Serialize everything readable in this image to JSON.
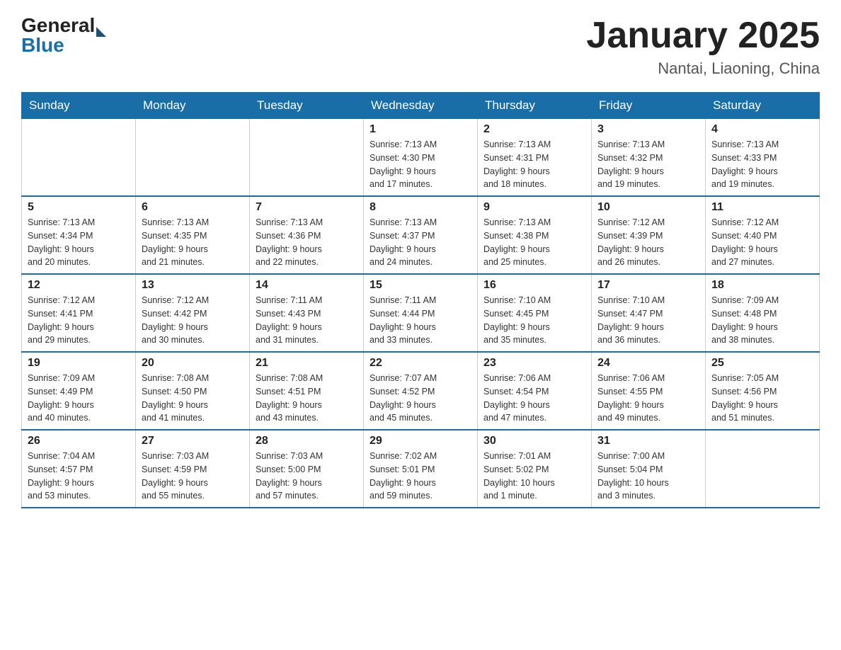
{
  "header": {
    "logo_general": "General",
    "logo_blue": "Blue",
    "title": "January 2025",
    "subtitle": "Nantai, Liaoning, China"
  },
  "days_of_week": [
    "Sunday",
    "Monday",
    "Tuesday",
    "Wednesday",
    "Thursday",
    "Friday",
    "Saturday"
  ],
  "weeks": [
    [
      {
        "day": "",
        "info": ""
      },
      {
        "day": "",
        "info": ""
      },
      {
        "day": "",
        "info": ""
      },
      {
        "day": "1",
        "info": "Sunrise: 7:13 AM\nSunset: 4:30 PM\nDaylight: 9 hours\nand 17 minutes."
      },
      {
        "day": "2",
        "info": "Sunrise: 7:13 AM\nSunset: 4:31 PM\nDaylight: 9 hours\nand 18 minutes."
      },
      {
        "day": "3",
        "info": "Sunrise: 7:13 AM\nSunset: 4:32 PM\nDaylight: 9 hours\nand 19 minutes."
      },
      {
        "day": "4",
        "info": "Sunrise: 7:13 AM\nSunset: 4:33 PM\nDaylight: 9 hours\nand 19 minutes."
      }
    ],
    [
      {
        "day": "5",
        "info": "Sunrise: 7:13 AM\nSunset: 4:34 PM\nDaylight: 9 hours\nand 20 minutes."
      },
      {
        "day": "6",
        "info": "Sunrise: 7:13 AM\nSunset: 4:35 PM\nDaylight: 9 hours\nand 21 minutes."
      },
      {
        "day": "7",
        "info": "Sunrise: 7:13 AM\nSunset: 4:36 PM\nDaylight: 9 hours\nand 22 minutes."
      },
      {
        "day": "8",
        "info": "Sunrise: 7:13 AM\nSunset: 4:37 PM\nDaylight: 9 hours\nand 24 minutes."
      },
      {
        "day": "9",
        "info": "Sunrise: 7:13 AM\nSunset: 4:38 PM\nDaylight: 9 hours\nand 25 minutes."
      },
      {
        "day": "10",
        "info": "Sunrise: 7:12 AM\nSunset: 4:39 PM\nDaylight: 9 hours\nand 26 minutes."
      },
      {
        "day": "11",
        "info": "Sunrise: 7:12 AM\nSunset: 4:40 PM\nDaylight: 9 hours\nand 27 minutes."
      }
    ],
    [
      {
        "day": "12",
        "info": "Sunrise: 7:12 AM\nSunset: 4:41 PM\nDaylight: 9 hours\nand 29 minutes."
      },
      {
        "day": "13",
        "info": "Sunrise: 7:12 AM\nSunset: 4:42 PM\nDaylight: 9 hours\nand 30 minutes."
      },
      {
        "day": "14",
        "info": "Sunrise: 7:11 AM\nSunset: 4:43 PM\nDaylight: 9 hours\nand 31 minutes."
      },
      {
        "day": "15",
        "info": "Sunrise: 7:11 AM\nSunset: 4:44 PM\nDaylight: 9 hours\nand 33 minutes."
      },
      {
        "day": "16",
        "info": "Sunrise: 7:10 AM\nSunset: 4:45 PM\nDaylight: 9 hours\nand 35 minutes."
      },
      {
        "day": "17",
        "info": "Sunrise: 7:10 AM\nSunset: 4:47 PM\nDaylight: 9 hours\nand 36 minutes."
      },
      {
        "day": "18",
        "info": "Sunrise: 7:09 AM\nSunset: 4:48 PM\nDaylight: 9 hours\nand 38 minutes."
      }
    ],
    [
      {
        "day": "19",
        "info": "Sunrise: 7:09 AM\nSunset: 4:49 PM\nDaylight: 9 hours\nand 40 minutes."
      },
      {
        "day": "20",
        "info": "Sunrise: 7:08 AM\nSunset: 4:50 PM\nDaylight: 9 hours\nand 41 minutes."
      },
      {
        "day": "21",
        "info": "Sunrise: 7:08 AM\nSunset: 4:51 PM\nDaylight: 9 hours\nand 43 minutes."
      },
      {
        "day": "22",
        "info": "Sunrise: 7:07 AM\nSunset: 4:52 PM\nDaylight: 9 hours\nand 45 minutes."
      },
      {
        "day": "23",
        "info": "Sunrise: 7:06 AM\nSunset: 4:54 PM\nDaylight: 9 hours\nand 47 minutes."
      },
      {
        "day": "24",
        "info": "Sunrise: 7:06 AM\nSunset: 4:55 PM\nDaylight: 9 hours\nand 49 minutes."
      },
      {
        "day": "25",
        "info": "Sunrise: 7:05 AM\nSunset: 4:56 PM\nDaylight: 9 hours\nand 51 minutes."
      }
    ],
    [
      {
        "day": "26",
        "info": "Sunrise: 7:04 AM\nSunset: 4:57 PM\nDaylight: 9 hours\nand 53 minutes."
      },
      {
        "day": "27",
        "info": "Sunrise: 7:03 AM\nSunset: 4:59 PM\nDaylight: 9 hours\nand 55 minutes."
      },
      {
        "day": "28",
        "info": "Sunrise: 7:03 AM\nSunset: 5:00 PM\nDaylight: 9 hours\nand 57 minutes."
      },
      {
        "day": "29",
        "info": "Sunrise: 7:02 AM\nSunset: 5:01 PM\nDaylight: 9 hours\nand 59 minutes."
      },
      {
        "day": "30",
        "info": "Sunrise: 7:01 AM\nSunset: 5:02 PM\nDaylight: 10 hours\nand 1 minute."
      },
      {
        "day": "31",
        "info": "Sunrise: 7:00 AM\nSunset: 5:04 PM\nDaylight: 10 hours\nand 3 minutes."
      },
      {
        "day": "",
        "info": ""
      }
    ]
  ]
}
